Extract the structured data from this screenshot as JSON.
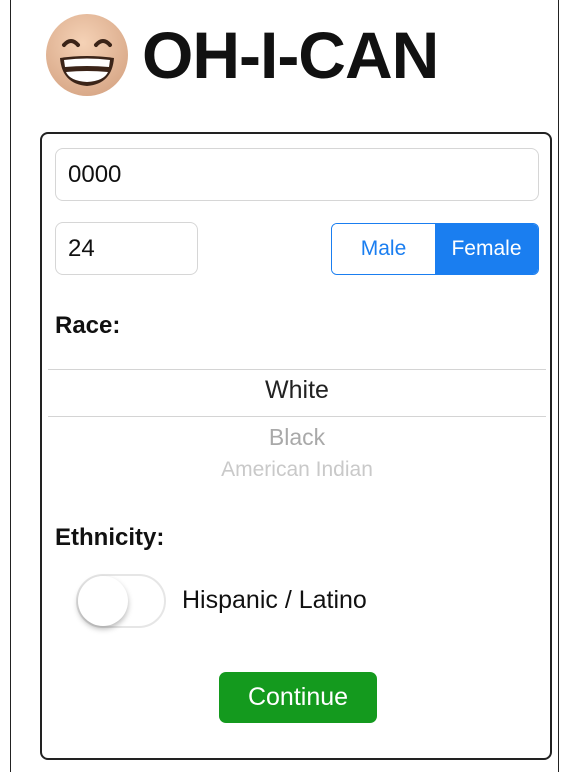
{
  "header": {
    "logo_icon": "grinning-face-emoji-icon",
    "title": "OH-I-CAN"
  },
  "form": {
    "id_field": {
      "value": "0000"
    },
    "age_field": {
      "value": "24"
    },
    "sex_selector": {
      "options": [
        "Male",
        "Female"
      ],
      "selected": "Female"
    },
    "race": {
      "label": "Race:",
      "picker": {
        "selected": "White",
        "next": "Black",
        "far": "American Indian"
      }
    },
    "ethnicity": {
      "label": "Ethnicity:",
      "toggle_label": "Hispanic / Latino",
      "toggle_on": false
    },
    "continue_label": "Continue"
  },
  "colors": {
    "accent_blue": "#1a7ef0",
    "continue_green": "#149a1e"
  }
}
